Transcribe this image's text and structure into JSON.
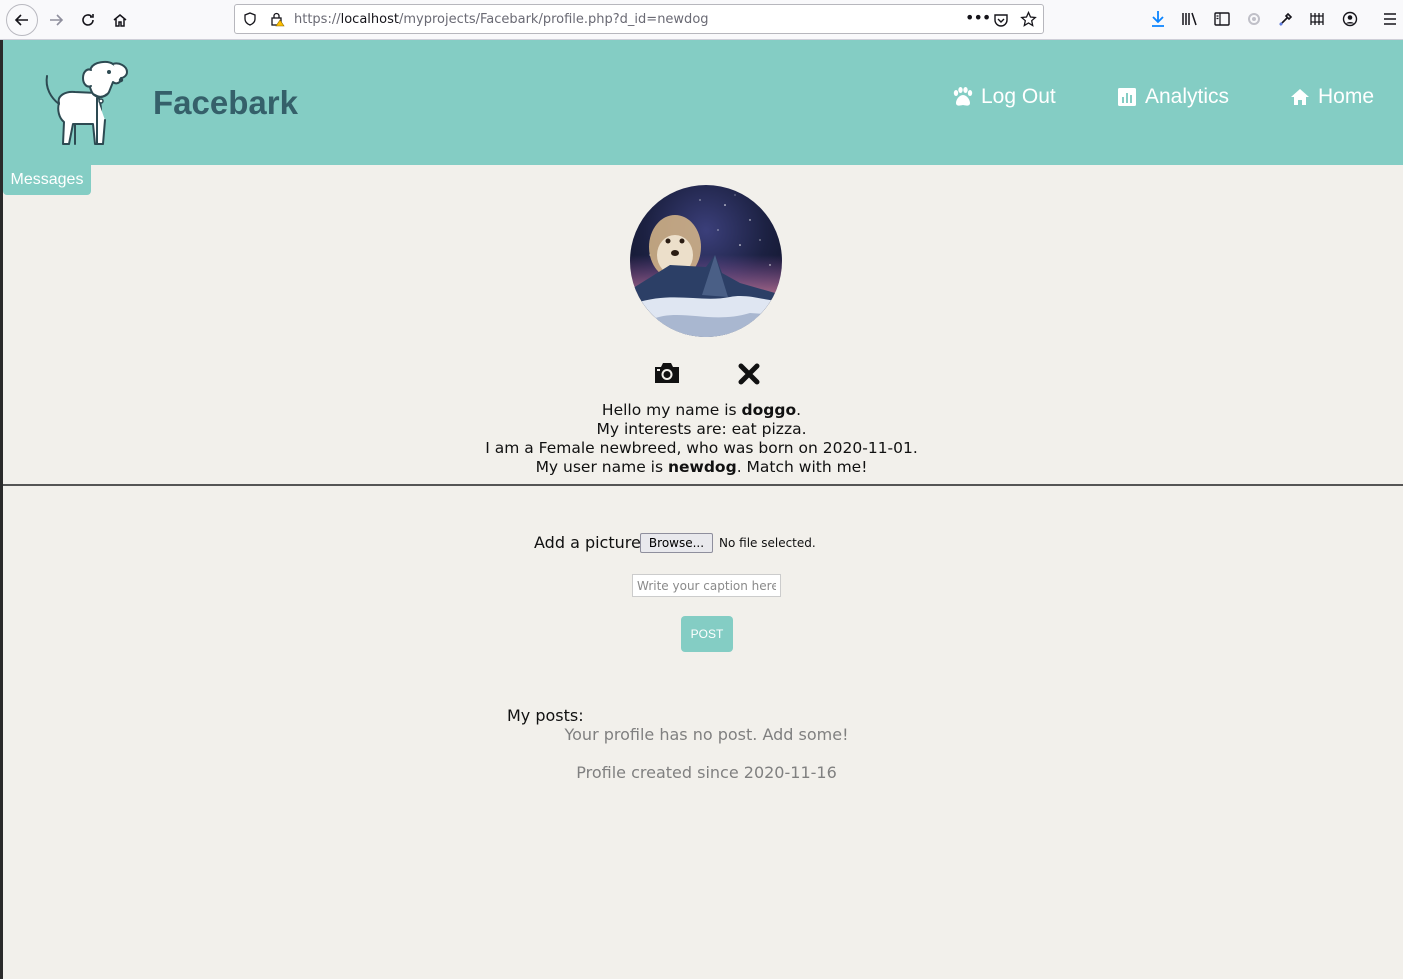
{
  "browser": {
    "url_prefix": "https://",
    "url_host": "localhost",
    "url_path": "/myprojects/Facebark/profile.php?d_id=newdog"
  },
  "header": {
    "brand": "Facebark",
    "nav": [
      {
        "label": "Log Out",
        "icon": "paw-icon"
      },
      {
        "label": "Analytics",
        "icon": "chart-icon"
      },
      {
        "label": "Home",
        "icon": "home-icon"
      }
    ],
    "messages_tab": "Messages"
  },
  "profile": {
    "line1_prefix": "Hello my name is ",
    "name": "doggo",
    "line1_suffix": ".",
    "line2": "My interests are: eat pizza.",
    "line3": "I am a Female newbreed, who was born on 2020-11-01.",
    "line4_prefix": "My user name is ",
    "username": "newdog",
    "line4_suffix": ". Match with me!"
  },
  "upload": {
    "label": "Add a picture:",
    "browse_label": "Browse...",
    "file_status": "No file selected.",
    "caption_placeholder": "Write your caption here..",
    "post_label": "POST"
  },
  "posts": {
    "heading": "My posts:",
    "empty_message": "Your profile has no post. Add some!",
    "created": "Profile created since 2020-11-16"
  },
  "colors": {
    "accent": "#84cdc4",
    "brand_text": "#35606a",
    "background": "#f2f0eb"
  }
}
